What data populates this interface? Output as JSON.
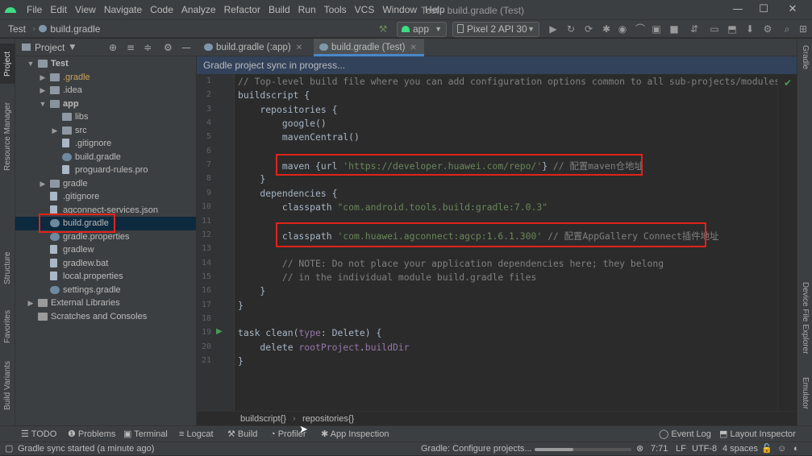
{
  "menu": {
    "items": [
      "File",
      "Edit",
      "View",
      "Navigate",
      "Code",
      "Analyze",
      "Refactor",
      "Build",
      "Run",
      "Tools",
      "VCS",
      "Window",
      "Help"
    ],
    "window_title": "Test - build.gradle (Test)"
  },
  "nav": {
    "project": "Test",
    "file": "build.gradle"
  },
  "toolbar": {
    "run_config": "app",
    "device": "Pixel 2 API 30"
  },
  "left_tabs": [
    "Project",
    "Resource Manager",
    "Structure",
    "Favorites",
    "Build Variants"
  ],
  "right_tabs": [
    "Gradle",
    "Device File Explorer",
    "Emulator"
  ],
  "project_panel": {
    "title": "Project"
  },
  "tree": [
    {
      "label": "Test",
      "indent": 0,
      "arrow": "▼",
      "icon": "folder",
      "bold": true
    },
    {
      "label": ".gradle",
      "indent": 1,
      "arrow": "▶",
      "icon": "folder",
      "color": "#c9a35e"
    },
    {
      "label": ".idea",
      "indent": 1,
      "arrow": "▶",
      "icon": "folder"
    },
    {
      "label": "app",
      "indent": 1,
      "arrow": "▼",
      "icon": "gfolder",
      "bold": true
    },
    {
      "label": "libs",
      "indent": 2,
      "arrow": "",
      "icon": "folder"
    },
    {
      "label": "src",
      "indent": 2,
      "arrow": "▶",
      "icon": "folder"
    },
    {
      "label": ".gitignore",
      "indent": 2,
      "arrow": "",
      "icon": "file"
    },
    {
      "label": "build.gradle",
      "indent": 2,
      "arrow": "",
      "icon": "gradle"
    },
    {
      "label": "proguard-rules.pro",
      "indent": 2,
      "arrow": "",
      "icon": "file"
    },
    {
      "label": "gradle",
      "indent": 1,
      "arrow": "▶",
      "icon": "folder"
    },
    {
      "label": ".gitignore",
      "indent": 1,
      "arrow": "",
      "icon": "file"
    },
    {
      "label": "agconnect-services.json",
      "indent": 1,
      "arrow": "",
      "icon": "file"
    },
    {
      "label": "build.gradle",
      "indent": 1,
      "arrow": "",
      "icon": "gradle",
      "selected": true
    },
    {
      "label": "gradle.properties",
      "indent": 1,
      "arrow": "",
      "icon": "gradle"
    },
    {
      "label": "gradlew",
      "indent": 1,
      "arrow": "",
      "icon": "file"
    },
    {
      "label": "gradlew.bat",
      "indent": 1,
      "arrow": "",
      "icon": "file"
    },
    {
      "label": "local.properties",
      "indent": 1,
      "arrow": "",
      "icon": "file"
    },
    {
      "label": "settings.gradle",
      "indent": 1,
      "arrow": "",
      "icon": "gradle"
    },
    {
      "label": "External Libraries",
      "indent": 0,
      "arrow": "▶",
      "icon": "lib"
    },
    {
      "label": "Scratches and Consoles",
      "indent": 0,
      "arrow": "",
      "icon": "lib"
    }
  ],
  "tabs": [
    {
      "label": "build.gradle (:app)",
      "active": false
    },
    {
      "label": "build.gradle (Test)",
      "active": true
    }
  ],
  "sync_message": "Gradle project sync in progress...",
  "code_lines": [
    [
      [
        "c-com",
        "// Top-level build file where you can add configuration options common to all sub-projects/modules."
      ]
    ],
    [
      [
        "c-fn",
        "buildscript {"
      ]
    ],
    [
      [
        "c-fn",
        "    repositories {"
      ]
    ],
    [
      [
        "c-fn",
        "        google()"
      ]
    ],
    [
      [
        "c-fn",
        "        mavenCentral()"
      ]
    ],
    [
      [
        "c-fn",
        ""
      ]
    ],
    [
      [
        "c-fn",
        "        maven {url "
      ],
      [
        "c-str",
        "'https://developer.huawei.com/repo/'"
      ],
      [
        "c-fn",
        "} "
      ],
      [
        "c-com",
        "// 配置maven仓地址"
      ]
    ],
    [
      [
        "c-fn",
        "    }"
      ]
    ],
    [
      [
        "c-fn",
        "    dependencies {"
      ]
    ],
    [
      [
        "c-fn",
        "        classpath "
      ],
      [
        "c-str",
        "\"com.android.tools.build:gradle:7.0.3\""
      ]
    ],
    [
      [
        "c-fn",
        ""
      ]
    ],
    [
      [
        "c-fn",
        "        classpath "
      ],
      [
        "c-str",
        "'com.huawei.agconnect:agcp:1.6.1.300'"
      ],
      [
        "c-fn",
        " "
      ],
      [
        "c-com",
        "// 配置AppGallery Connect插件地址"
      ]
    ],
    [
      [
        "c-fn",
        ""
      ]
    ],
    [
      [
        "c-com",
        "        // NOTE: Do not place your application dependencies here; they belong"
      ]
    ],
    [
      [
        "c-com",
        "        // in the individual module build.gradle files"
      ]
    ],
    [
      [
        "c-fn",
        "    }"
      ]
    ],
    [
      [
        "c-fn",
        "}"
      ]
    ],
    [
      [
        "c-fn",
        ""
      ]
    ],
    [
      [
        "c-fn",
        "task clean("
      ],
      [
        "c-prop",
        "type"
      ],
      [
        "c-fn",
        ": Delete) {"
      ]
    ],
    [
      [
        "c-fn",
        "    delete "
      ],
      [
        "c-prop",
        "rootProject"
      ],
      [
        "c-fn",
        "."
      ],
      [
        "c-prop",
        "buildDir"
      ]
    ],
    [
      [
        "c-fn",
        "}"
      ]
    ]
  ],
  "breadcrumb": [
    "buildscript{}",
    "repositories{}"
  ],
  "bottom_tools": [
    "TODO",
    "Problems",
    "Terminal",
    "Logcat",
    "Build",
    "Profiler",
    "App Inspection",
    "Event Log",
    "Layout Inspector"
  ],
  "status": {
    "left": "Gradle sync started (a minute ago)",
    "task": "Gradle: Configure projects...",
    "position": "7:71",
    "line_sep": "LF",
    "encoding": "UTF-8",
    "indent": "4 spaces"
  }
}
